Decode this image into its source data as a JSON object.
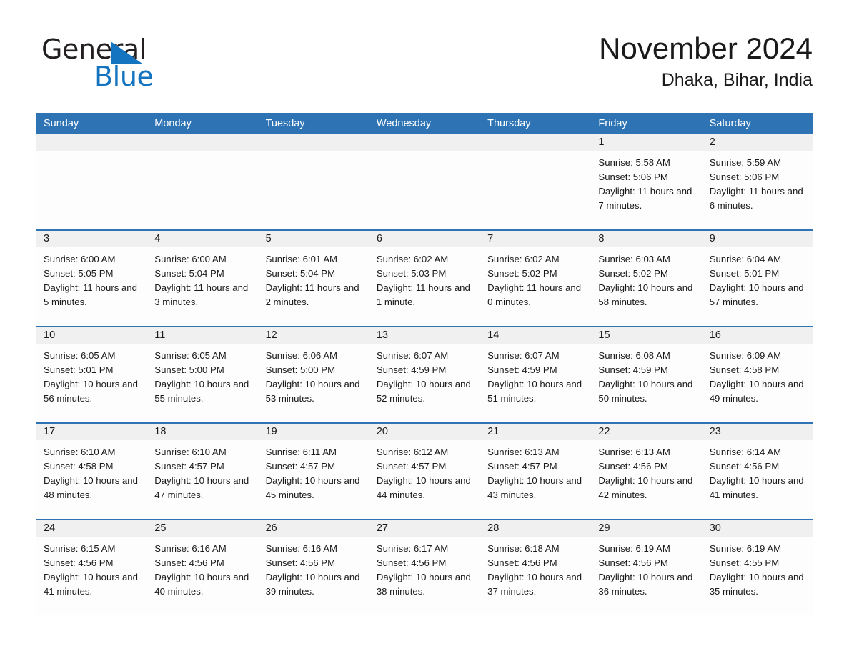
{
  "brand": {
    "name_dark": "General",
    "name_blue": "Blue",
    "accent_color": "#1574bf"
  },
  "header": {
    "title": "November 2024",
    "subtitle": "Dhaka, Bihar, India"
  },
  "theme": {
    "header_row_color": "#2e74b5",
    "daynum_band_color": "#f0f0f0",
    "text_color": "#1a1a1a"
  },
  "weekdays": [
    "Sunday",
    "Monday",
    "Tuesday",
    "Wednesday",
    "Thursday",
    "Friday",
    "Saturday"
  ],
  "weeks": [
    [
      {
        "day": "",
        "empty": true
      },
      {
        "day": "",
        "empty": true
      },
      {
        "day": "",
        "empty": true
      },
      {
        "day": "",
        "empty": true
      },
      {
        "day": "",
        "empty": true
      },
      {
        "day": "1",
        "sunrise": "Sunrise: 5:58 AM",
        "sunset": "Sunset: 5:06 PM",
        "daylight": "Daylight: 11 hours and 7 minutes."
      },
      {
        "day": "2",
        "sunrise": "Sunrise: 5:59 AM",
        "sunset": "Sunset: 5:06 PM",
        "daylight": "Daylight: 11 hours and 6 minutes."
      }
    ],
    [
      {
        "day": "3",
        "sunrise": "Sunrise: 6:00 AM",
        "sunset": "Sunset: 5:05 PM",
        "daylight": "Daylight: 11 hours and 5 minutes."
      },
      {
        "day": "4",
        "sunrise": "Sunrise: 6:00 AM",
        "sunset": "Sunset: 5:04 PM",
        "daylight": "Daylight: 11 hours and 3 minutes."
      },
      {
        "day": "5",
        "sunrise": "Sunrise: 6:01 AM",
        "sunset": "Sunset: 5:04 PM",
        "daylight": "Daylight: 11 hours and 2 minutes."
      },
      {
        "day": "6",
        "sunrise": "Sunrise: 6:02 AM",
        "sunset": "Sunset: 5:03 PM",
        "daylight": "Daylight: 11 hours and 1 minute."
      },
      {
        "day": "7",
        "sunrise": "Sunrise: 6:02 AM",
        "sunset": "Sunset: 5:02 PM",
        "daylight": "Daylight: 11 hours and 0 minutes."
      },
      {
        "day": "8",
        "sunrise": "Sunrise: 6:03 AM",
        "sunset": "Sunset: 5:02 PM",
        "daylight": "Daylight: 10 hours and 58 minutes."
      },
      {
        "day": "9",
        "sunrise": "Sunrise: 6:04 AM",
        "sunset": "Sunset: 5:01 PM",
        "daylight": "Daylight: 10 hours and 57 minutes."
      }
    ],
    [
      {
        "day": "10",
        "sunrise": "Sunrise: 6:05 AM",
        "sunset": "Sunset: 5:01 PM",
        "daylight": "Daylight: 10 hours and 56 minutes."
      },
      {
        "day": "11",
        "sunrise": "Sunrise: 6:05 AM",
        "sunset": "Sunset: 5:00 PM",
        "daylight": "Daylight: 10 hours and 55 minutes."
      },
      {
        "day": "12",
        "sunrise": "Sunrise: 6:06 AM",
        "sunset": "Sunset: 5:00 PM",
        "daylight": "Daylight: 10 hours and 53 minutes."
      },
      {
        "day": "13",
        "sunrise": "Sunrise: 6:07 AM",
        "sunset": "Sunset: 4:59 PM",
        "daylight": "Daylight: 10 hours and 52 minutes."
      },
      {
        "day": "14",
        "sunrise": "Sunrise: 6:07 AM",
        "sunset": "Sunset: 4:59 PM",
        "daylight": "Daylight: 10 hours and 51 minutes."
      },
      {
        "day": "15",
        "sunrise": "Sunrise: 6:08 AM",
        "sunset": "Sunset: 4:59 PM",
        "daylight": "Daylight: 10 hours and 50 minutes."
      },
      {
        "day": "16",
        "sunrise": "Sunrise: 6:09 AM",
        "sunset": "Sunset: 4:58 PM",
        "daylight": "Daylight: 10 hours and 49 minutes."
      }
    ],
    [
      {
        "day": "17",
        "sunrise": "Sunrise: 6:10 AM",
        "sunset": "Sunset: 4:58 PM",
        "daylight": "Daylight: 10 hours and 48 minutes."
      },
      {
        "day": "18",
        "sunrise": "Sunrise: 6:10 AM",
        "sunset": "Sunset: 4:57 PM",
        "daylight": "Daylight: 10 hours and 47 minutes."
      },
      {
        "day": "19",
        "sunrise": "Sunrise: 6:11 AM",
        "sunset": "Sunset: 4:57 PM",
        "daylight": "Daylight: 10 hours and 45 minutes."
      },
      {
        "day": "20",
        "sunrise": "Sunrise: 6:12 AM",
        "sunset": "Sunset: 4:57 PM",
        "daylight": "Daylight: 10 hours and 44 minutes."
      },
      {
        "day": "21",
        "sunrise": "Sunrise: 6:13 AM",
        "sunset": "Sunset: 4:57 PM",
        "daylight": "Daylight: 10 hours and 43 minutes."
      },
      {
        "day": "22",
        "sunrise": "Sunrise: 6:13 AM",
        "sunset": "Sunset: 4:56 PM",
        "daylight": "Daylight: 10 hours and 42 minutes."
      },
      {
        "day": "23",
        "sunrise": "Sunrise: 6:14 AM",
        "sunset": "Sunset: 4:56 PM",
        "daylight": "Daylight: 10 hours and 41 minutes."
      }
    ],
    [
      {
        "day": "24",
        "sunrise": "Sunrise: 6:15 AM",
        "sunset": "Sunset: 4:56 PM",
        "daylight": "Daylight: 10 hours and 41 minutes."
      },
      {
        "day": "25",
        "sunrise": "Sunrise: 6:16 AM",
        "sunset": "Sunset: 4:56 PM",
        "daylight": "Daylight: 10 hours and 40 minutes."
      },
      {
        "day": "26",
        "sunrise": "Sunrise: 6:16 AM",
        "sunset": "Sunset: 4:56 PM",
        "daylight": "Daylight: 10 hours and 39 minutes."
      },
      {
        "day": "27",
        "sunrise": "Sunrise: 6:17 AM",
        "sunset": "Sunset: 4:56 PM",
        "daylight": "Daylight: 10 hours and 38 minutes."
      },
      {
        "day": "28",
        "sunrise": "Sunrise: 6:18 AM",
        "sunset": "Sunset: 4:56 PM",
        "daylight": "Daylight: 10 hours and 37 minutes."
      },
      {
        "day": "29",
        "sunrise": "Sunrise: 6:19 AM",
        "sunset": "Sunset: 4:56 PM",
        "daylight": "Daylight: 10 hours and 36 minutes."
      },
      {
        "day": "30",
        "sunrise": "Sunrise: 6:19 AM",
        "sunset": "Sunset: 4:55 PM",
        "daylight": "Daylight: 10 hours and 35 minutes."
      }
    ]
  ]
}
